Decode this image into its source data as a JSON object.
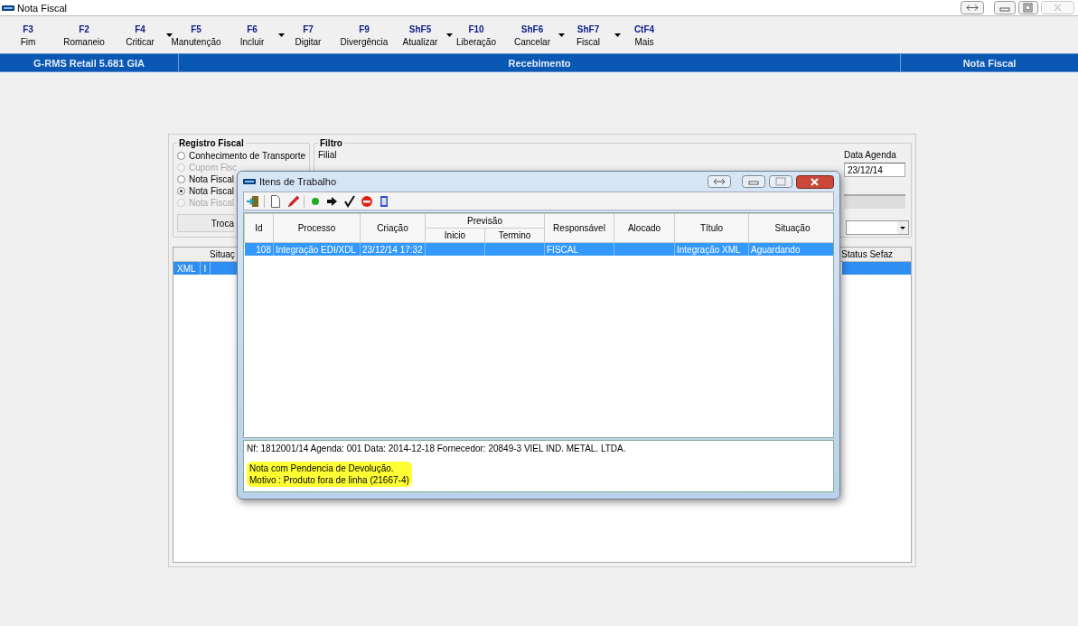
{
  "window": {
    "title": "Nota Fiscal"
  },
  "toolbar": [
    {
      "key": "F3",
      "label": "Fim",
      "has_menu": false
    },
    {
      "key": "F2",
      "label": "Romaneio",
      "has_menu": false
    },
    {
      "key": "F4",
      "label": "Criticar",
      "has_menu": true
    },
    {
      "key": "F5",
      "label": "Manutenção",
      "has_menu": false
    },
    {
      "key": "F6",
      "label": "Incluir",
      "has_menu": true
    },
    {
      "key": "F7",
      "label": "Digitar",
      "has_menu": false
    },
    {
      "key": "F9",
      "label": "Divergência",
      "has_menu": false
    },
    {
      "key": "ShF5",
      "label": "Atualizar",
      "has_menu": true
    },
    {
      "key": "F10",
      "label": "Liberação",
      "has_menu": false
    },
    {
      "key": "ShF6",
      "label": "Cancelar",
      "has_menu": true
    },
    {
      "key": "ShF7",
      "label": "Fiscal",
      "has_menu": true
    },
    {
      "key": "CtF4",
      "label": "Mais",
      "has_menu": false
    }
  ],
  "header_bar": [
    "G-RMS Retail 5.681 GIA",
    "Recebimento",
    "Nota Fiscal"
  ],
  "registro_fiscal": {
    "title": "Registro Fiscal",
    "options": [
      {
        "label": "Conhecimento de Transporte",
        "selected": false,
        "disabled": false
      },
      {
        "label": "Cupom Fisc",
        "selected": false,
        "disabled": true
      },
      {
        "label": "Nota Fiscal",
        "selected": false,
        "disabled": false
      },
      {
        "label": "Nota Fiscal",
        "selected": true,
        "disabled": false
      },
      {
        "label": "Nota Fiscal",
        "selected": false,
        "disabled": true
      }
    ],
    "button": "Troca"
  },
  "filtro": {
    "title": "Filtro",
    "filial_label": "Filial",
    "data_agenda_label": "Data Agenda",
    "data_agenda": "23/12/14"
  },
  "grid": {
    "columns": [
      "Situaç",
      "Status Sefaz"
    ],
    "row": [
      "XML",
      "I"
    ]
  },
  "dialog": {
    "title": "Itens de Trabalho",
    "column_group": "Previsão",
    "columns": [
      {
        "label": "Id",
        "in_group": false
      },
      {
        "label": "Processo",
        "in_group": false
      },
      {
        "label": "Criação",
        "in_group": false
      },
      {
        "label": "Inicio",
        "in_group": true
      },
      {
        "label": "Termino",
        "in_group": true
      },
      {
        "label": "Responsável",
        "in_group": false
      },
      {
        "label": "Alocado",
        "in_group": false
      },
      {
        "label": "Título",
        "in_group": false
      },
      {
        "label": "Situação",
        "in_group": false
      }
    ],
    "rows": [
      {
        "selected": true,
        "cells": [
          "108",
          "Integração EDI/XDL",
          "23/12/14 17:32",
          "",
          "",
          "FISCAL",
          "",
          "Integração XML",
          "Aguardando"
        ]
      }
    ],
    "details": {
      "info": "Nf: 1812001/14  Agenda: 001 Data: 2014-12-18 Fornecedor: 20849-3 VIEL IND. METAL. LTDA.",
      "highlighted": [
        "Nota com Pendencia de Devolução.",
        "Motivo : Produto fora de linha (21667-4)"
      ]
    }
  }
}
